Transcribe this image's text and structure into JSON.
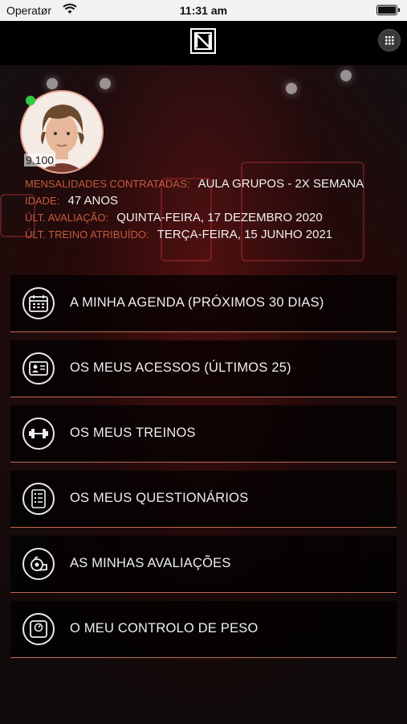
{
  "status_bar": {
    "carrier": "Operatør",
    "time": "11:31 am"
  },
  "nav": {
    "logo_icon": "brand-logo",
    "grid_icon": "grid-menu-icon"
  },
  "profile": {
    "member_number": "9.100",
    "online": true,
    "fields": [
      {
        "label": "MENSALIDADES CONTRATADAS:",
        "value": "AULA GRUPOS - 2X SEMANA"
      },
      {
        "label": "IDADE:",
        "value": "47 ANOS"
      },
      {
        "label": "ÚLT. AVALIAÇÃO:",
        "value": "QUINTA-FEIRA, 17 DEZEMBRO 2020"
      },
      {
        "label": "ÚLT. TREINO ATRIBUÍDO:",
        "value": "TERÇA-FEIRA, 15 JUNHO 2021"
      }
    ]
  },
  "menu": [
    {
      "label": "A MINHA AGENDA (PRÓXIMOS 30 DIAS)",
      "icon": "calendar-icon"
    },
    {
      "label": "OS MEUS ACESSOS (ÚLTIMOS 25)",
      "icon": "id-card-icon"
    },
    {
      "label": "OS MEUS TREINOS",
      "icon": "dumbbell-icon"
    },
    {
      "label": "OS MEUS QUESTIONÁRIOS",
      "icon": "checklist-icon"
    },
    {
      "label": "AS MINHAS AVALIAÇÕES",
      "icon": "measuring-tape-icon"
    },
    {
      "label": "O MEU CONTROLO DE PESO",
      "icon": "scale-icon"
    }
  ],
  "colors": {
    "accent": "#c45a3e",
    "divider": "#c06a4d",
    "online": "#2ecc40"
  }
}
